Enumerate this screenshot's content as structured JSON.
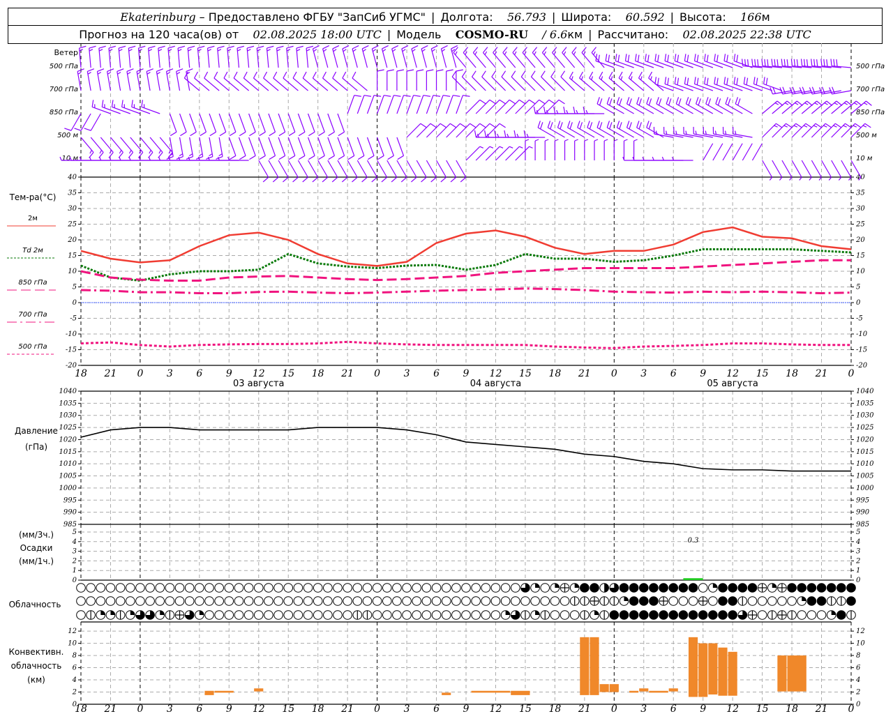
{
  "header": {
    "city": "Ekaterinburg",
    "provider": " – Предоставлено ФГБУ \"ЗапСиб УГМС\"",
    "lon_label": "Долгота:",
    "lon": "56.793",
    "lat_label": "Широта:",
    "lat": "60.592",
    "alt_label": "Высота:",
    "alt": "166",
    "alt_unit": "м",
    "forecast_label": "Прогноз на 120 часа(ов) от",
    "forecast_start": "02.08.2025 18:00 UTC",
    "model_label": "Модель",
    "model": "COSMO-RU",
    "resolution": "/ 6.6",
    "resolution_unit": "км",
    "computed_label": "Рассчитано:",
    "computed": "02.08.2025 22:38 UTC"
  },
  "time_axis": {
    "hour_labels": [
      "18",
      "21",
      "0",
      "3",
      "6",
      "9",
      "12",
      "15",
      "18",
      "21",
      "0",
      "3",
      "6",
      "9",
      "12",
      "15",
      "18",
      "21",
      "0",
      "3",
      "6",
      "9",
      "12",
      "15",
      "18",
      "21",
      "0"
    ],
    "date_labels": [
      "03 августа",
      "04 августа",
      "05 августа"
    ]
  },
  "labels": {
    "wind": "Ветер",
    "wind_levels": [
      "500 гПа",
      "700 гПа",
      "850 гПа",
      "500 м",
      "10  м"
    ],
    "temp": "Тем-ра(°C)",
    "temp_legend": [
      "2м",
      "Td  2м",
      "850 гПа",
      "700 гПа",
      "500 гПа"
    ],
    "pressure": [
      "Давление",
      "(гПа)"
    ],
    "precip": [
      "(мм/3ч.)",
      "Осадки",
      "(мм/1ч.)"
    ],
    "clouds": "Облачность",
    "convective": [
      "Конвективн.",
      "облачность",
      "(км)"
    ]
  },
  "colors": {
    "wind": "#8a00ff",
    "t2m": "#f03c32",
    "td2m": "#0a7a0a",
    "t850": "#f0147f",
    "t700": "#f0147f",
    "t500": "#f0147f",
    "zero": "#3050ff",
    "precip": "#22cc22",
    "convective": "#f0882a"
  },
  "chart_data": [
    {
      "type": "wind_barbs",
      "title": "Ветер",
      "step_hours": 3,
      "levels": [
        {
          "name": "500 гПа",
          "dir_speed": [
            [
              355,
              8
            ],
            [
              355,
              8
            ],
            [
              355,
              8
            ],
            [
              355,
              8
            ],
            [
              355,
              8
            ],
            [
              355,
              8
            ],
            [
              355,
              8
            ],
            [
              355,
              8
            ],
            [
              345,
              8
            ],
            [
              345,
              8
            ],
            [
              345,
              8
            ],
            [
              345,
              8
            ],
            [
              345,
              8
            ],
            [
              320,
              8
            ],
            [
              320,
              8
            ],
            [
              320,
              8
            ],
            [
              320,
              8
            ],
            [
              320,
              8
            ],
            [
              290,
              12
            ],
            [
              290,
              12
            ],
            [
              290,
              12
            ],
            [
              290,
              12
            ],
            [
              290,
              12
            ],
            [
              275,
              17
            ],
            [
              275,
              17
            ],
            [
              275,
              17
            ],
            [
              275,
              17
            ]
          ]
        },
        {
          "name": "700 гПа",
          "dir_speed": [
            [
              350,
              8
            ],
            [
              350,
              8
            ],
            [
              350,
              8
            ],
            [
              350,
              8
            ],
            [
              310,
              6
            ],
            [
              310,
              6
            ],
            [
              310,
              6
            ],
            [
              310,
              6
            ],
            [
              310,
              6
            ],
            [
              310,
              6
            ],
            [
              0,
              5
            ],
            [
              0,
              5
            ],
            [
              0,
              5
            ],
            [
              315,
              6
            ],
            [
              315,
              6
            ],
            [
              315,
              6
            ],
            [
              315,
              6
            ],
            [
              310,
              8
            ],
            [
              310,
              8
            ],
            [
              310,
              8
            ],
            [
              290,
              12
            ],
            [
              290,
              12
            ],
            [
              290,
              12
            ],
            [
              290,
              12
            ],
            [
              260,
              12
            ],
            [
              260,
              12
            ],
            [
              260,
              12
            ]
          ]
        },
        {
          "name": "850 гПа",
          "dir_speed": [
            [
              210,
              5
            ],
            [
              290,
              8
            ],
            [
              290,
              8
            ],
            [
              160,
              5
            ],
            [
              160,
              5
            ],
            [
              160,
              5
            ],
            [
              160,
              5
            ],
            [
              160,
              5
            ],
            [
              160,
              5
            ],
            [
              20,
              5
            ],
            [
              20,
              5
            ],
            [
              20,
              5
            ],
            [
              20,
              5
            ],
            [
              45,
              6
            ],
            [
              45,
              6
            ],
            [
              45,
              6
            ],
            [
              270,
              8
            ],
            [
              270,
              8
            ],
            [
              300,
              10
            ],
            [
              300,
              10
            ],
            [
              300,
              10
            ],
            [
              300,
              10
            ],
            [
              300,
              10
            ],
            [
              50,
              8
            ],
            [
              50,
              8
            ],
            [
              50,
              8
            ],
            [
              50,
              8
            ]
          ]
        },
        {
          "name": "500 м",
          "dir_speed": [
            [
              140,
              8
            ],
            [
              140,
              8
            ],
            [
              140,
              8
            ],
            [
              170,
              8
            ],
            [
              170,
              8
            ],
            [
              160,
              5
            ],
            [
              160,
              5
            ],
            [
              160,
              5
            ],
            [
              160,
              5
            ],
            [
              160,
              5
            ],
            [
              160,
              5
            ],
            [
              45,
              7
            ],
            [
              45,
              7
            ],
            [
              45,
              7
            ],
            [
              270,
              9
            ],
            [
              270,
              9
            ],
            [
              300,
              10
            ],
            [
              300,
              10
            ],
            [
              300,
              10
            ],
            [
              300,
              10
            ],
            [
              280,
              9
            ],
            [
              280,
              9
            ],
            [
              280,
              9
            ],
            [
              45,
              8
            ],
            [
              45,
              8
            ],
            [
              45,
              8
            ],
            [
              45,
              8
            ]
          ]
        },
        {
          "name": "10 м",
          "dir_speed": [
            [
              270,
              4
            ],
            [
              270,
              4
            ],
            [
              270,
              4
            ],
            [
              270,
              4
            ],
            [
              270,
              4
            ],
            [
              270,
              4
            ],
            [
              150,
              5
            ],
            [
              150,
              5
            ],
            [
              150,
              5
            ],
            [
              150,
              5
            ],
            [
              150,
              5
            ],
            [
              150,
              5
            ],
            [
              150,
              5
            ],
            [
              45,
              3
            ],
            [
              45,
              3
            ],
            [
              0,
              3
            ],
            [
              0,
              3
            ],
            [
              0,
              3
            ],
            [
              0,
              3
            ],
            [
              270,
              3
            ],
            [
              270,
              3
            ],
            [
              30,
              2
            ],
            [
              30,
              2
            ],
            [
              150,
              3
            ],
            [
              150,
              3
            ],
            [
              150,
              3
            ],
            [
              150,
              3
            ]
          ]
        }
      ]
    },
    {
      "type": "line",
      "title": "Тем-ра(°C)",
      "step_hours": 3,
      "ylim": [
        -20,
        40
      ],
      "yticks": [
        40,
        35,
        30,
        25,
        20,
        15,
        10,
        5,
        0,
        -5,
        -10,
        -15,
        -20
      ],
      "grid": true,
      "series": [
        {
          "name": "2м",
          "values": [
            16.5,
            14,
            12.8,
            13.5,
            18,
            21.5,
            22.3,
            20,
            15.5,
            12.5,
            11.7,
            13,
            19,
            22,
            23,
            21,
            17.5,
            15.5,
            16.5,
            16.5,
            18.5,
            22.5,
            24,
            21,
            20.5,
            18,
            17
          ]
        },
        {
          "name": "Td 2м",
          "values": [
            11.8,
            8,
            7,
            9,
            10,
            10,
            10.5,
            15.5,
            12.5,
            11.5,
            11,
            11.8,
            12,
            10.5,
            12,
            15.5,
            14,
            14,
            13,
            13.5,
            15,
            17,
            17,
            17,
            17,
            16.5,
            16
          ]
        },
        {
          "name": "850 гПа",
          "values": [
            10,
            8,
            7.3,
            7,
            7,
            8,
            8.3,
            8.5,
            8,
            7.5,
            7.2,
            7.5,
            8,
            8.5,
            9.5,
            10,
            10.5,
            11,
            11,
            11,
            11,
            11.5,
            12,
            12.5,
            13,
            13.5,
            13.5
          ]
        },
        {
          "name": "700 гПа",
          "values": [
            4,
            3.8,
            3.3,
            3.3,
            3,
            3,
            3.4,
            3.5,
            3.2,
            3,
            3.2,
            3.5,
            3.8,
            4,
            4.2,
            4.5,
            4.3,
            4,
            3.5,
            3.3,
            3.2,
            3.5,
            3.3,
            3.5,
            3.3,
            3,
            3.2
          ]
        },
        {
          "name": "500 гПа",
          "values": [
            -13,
            -12.7,
            -13.5,
            -14,
            -13.5,
            -13.3,
            -13.2,
            -13.2,
            -13,
            -12.5,
            -13,
            -13.3,
            -13.5,
            -13.5,
            -13.5,
            -13.5,
            -14,
            -14.3,
            -14.5,
            -14,
            -13.8,
            -13.5,
            -13,
            -13,
            -13.3,
            -13.5,
            -13.5
          ]
        }
      ]
    },
    {
      "type": "line",
      "title": "Давление (гПа)",
      "step_hours": 3,
      "ylim": [
        985,
        1040
      ],
      "yticks": [
        1040,
        1035,
        1030,
        1025,
        1020,
        1015,
        1010,
        1005,
        1000,
        995,
        990,
        985
      ],
      "grid": true,
      "series": [
        {
          "name": "Давление",
          "values": [
            1021,
            1024,
            1025,
            1025,
            1024,
            1024,
            1024,
            1024,
            1025,
            1025,
            1025,
            1024,
            1022,
            1019,
            1018,
            1017,
            1016,
            1014,
            1013,
            1011,
            1010,
            1008,
            1007.5,
            1007.5,
            1007,
            1007,
            1007
          ]
        }
      ]
    },
    {
      "type": "bar",
      "title": "Осадки",
      "ylim": [
        0,
        5
      ],
      "yticks": [
        5,
        4,
        3,
        2,
        1,
        0
      ],
      "bars": [
        {
          "start_hour": 61,
          "end_hour": 63,
          "value": 0.2
        }
      ],
      "annotation": "0.3"
    },
    {
      "type": "cloud_cover",
      "title": "Облачность",
      "legend": "o=clear, v=1/8, q=1/4, h=1/2, x=split, t=3/4, f=overcast",
      "rows": [
        "oooooooooooooooooooooooooooooooooooooooooooootqoqxqffhtffffffffoqffffxqxffffffft",
        "oooooooooooooooooooooooooooooooooooooooooooooooooovvxvvqfffxoooxoffvoooooqffvvfffff",
        "ovqqvqttqvxtqooooooooooooooovvoooooooooooooqtvqvooovqvffffffffffffftxovxvoooqfvvvoot"
      ]
    },
    {
      "type": "floating_bar",
      "title": "Конвективн. облачность (км)",
      "ylim": [
        0,
        13.5
      ],
      "yticks": [
        12,
        10,
        8,
        6,
        4,
        2,
        0
      ],
      "bars": [
        {
          "start_hour": 12.5,
          "end_hour": 13.5,
          "bottom": 1.5,
          "top": 2.2
        },
        {
          "start_hour": 13.5,
          "end_hour": 15.5,
          "bottom": 1.9,
          "top": 2.2
        },
        {
          "start_hour": 17.5,
          "end_hour": 18.5,
          "bottom": 2.1,
          "top": 2.6
        },
        {
          "start_hour": 36.5,
          "end_hour": 37.5,
          "bottom": 1.5,
          "top": 1.9
        },
        {
          "start_hour": 39.5,
          "end_hour": 43.5,
          "bottom": 1.9,
          "top": 2.2
        },
        {
          "start_hour": 43.5,
          "end_hour": 45.5,
          "bottom": 1.5,
          "top": 2.2
        },
        {
          "start_hour": 50.5,
          "end_hour": 51.5,
          "bottom": 1.5,
          "top": 11
        },
        {
          "start_hour": 51.5,
          "end_hour": 52.5,
          "bottom": 1.5,
          "top": 11
        },
        {
          "start_hour": 52.5,
          "end_hour": 53.5,
          "bottom": 2,
          "top": 3.3
        },
        {
          "start_hour": 53.5,
          "end_hour": 54.5,
          "bottom": 2,
          "top": 3.3
        },
        {
          "start_hour": 55.5,
          "end_hour": 56.5,
          "bottom": 1.9,
          "top": 2.2
        },
        {
          "start_hour": 56.5,
          "end_hour": 57.5,
          "bottom": 2.1,
          "top": 2.6
        },
        {
          "start_hour": 57.5,
          "end_hour": 59.5,
          "bottom": 1.9,
          "top": 2.2
        },
        {
          "start_hour": 59.5,
          "end_hour": 60.5,
          "bottom": 2.1,
          "top": 2.6
        },
        {
          "start_hour": 61.5,
          "end_hour": 62.5,
          "bottom": 1.2,
          "top": 11
        },
        {
          "start_hour": 62.5,
          "end_hour": 63.5,
          "bottom": 1.2,
          "top": 10
        },
        {
          "start_hour": 63.5,
          "end_hour": 64.5,
          "bottom": 1.6,
          "top": 10
        },
        {
          "start_hour": 64.5,
          "end_hour": 65.5,
          "bottom": 1.4,
          "top": 9.3
        },
        {
          "start_hour": 65.5,
          "end_hour": 66.5,
          "bottom": 1.4,
          "top": 8.6
        },
        {
          "start_hour": 70.5,
          "end_hour": 71.5,
          "bottom": 2.1,
          "top": 8
        },
        {
          "start_hour": 71.5,
          "end_hour": 73.5,
          "bottom": 2.1,
          "top": 8
        }
      ]
    }
  ]
}
